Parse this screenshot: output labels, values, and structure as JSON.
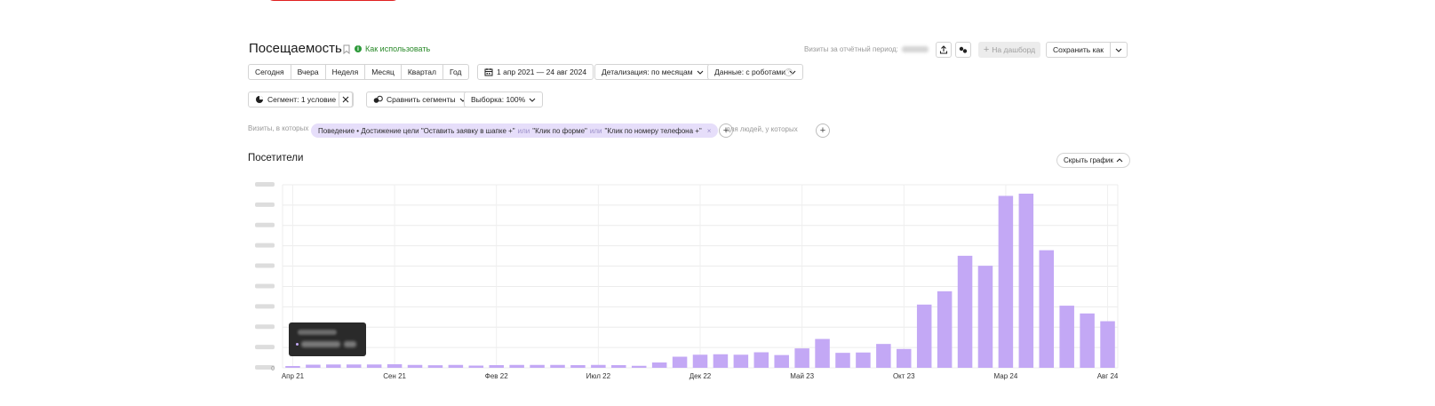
{
  "header": {
    "title": "Посещаемость",
    "how_to_use": "Как использовать",
    "visits_period_label": "Визиты за отчётный период:",
    "to_dashboard": "На дашборд",
    "save_as": "Сохранить как"
  },
  "period_buttons": [
    "Сегодня",
    "Вчера",
    "Неделя",
    "Месяц",
    "Квартал",
    "Год"
  ],
  "date_range": "1 апр 2021 — 24 авг 2024",
  "detail": "Детализация: по месяцам",
  "data_mode": "Данные: с роботами",
  "segment": "Сегмент: 1 условие",
  "compare_segments": "Сравнить сегменты",
  "sample": "Выборка: 100%",
  "filter": {
    "visits_where": "Визиты, в которых",
    "chip_part1": "Поведение • Достижение цели \"Оставить заявку в шапке +\"",
    "or1": "или",
    "chip_part2": "\"Клик по форме\"",
    "or2": "или",
    "chip_part3": "\"Клик по номеру телефона +\"",
    "people_where": "для людей, у которых"
  },
  "section": {
    "title": "Посетители",
    "hide_chart": "Скрыть график"
  },
  "colors": {
    "bar": "#c3a8f5",
    "green": "#2d9a3a"
  },
  "chart_data": {
    "type": "bar",
    "series": [
      {
        "values": [
          120,
          280,
          300,
          300,
          300,
          320,
          260,
          230,
          260,
          200,
          240,
          260,
          260,
          260,
          240,
          260,
          240,
          180,
          480,
          1000,
          1180,
          1220,
          1180,
          1400,
          1150,
          1750,
          2600,
          1350,
          1380,
          2150,
          1700,
          5700,
          6900,
          10100,
          9200,
          15500,
          15700,
          10600,
          5600,
          4900,
          4200
        ]
      }
    ],
    "categories": [
      "Апр 21",
      "Май 21",
      "Июн 21",
      "Июл 21",
      "Авг 21",
      "Сен 21",
      "Окт 21",
      "Ноя 21",
      "Дек 21",
      "Янв 22",
      "Фев 22",
      "Мар 22",
      "Апр 22",
      "Май 22",
      "Июн 22",
      "Июл 22",
      "Авг 22",
      "Сен 22",
      "Окт 22",
      "Ноя 22",
      "Дек 22",
      "Янв 23",
      "Фев 23",
      "Мар 23",
      "Апр 23",
      "Май 23",
      "Июн 23",
      "Июл 23",
      "Авг 23",
      "Сен 23",
      "Окт 23",
      "Ноя 23",
      "Дек 23",
      "Янв 24",
      "Фев 24",
      "Мар 24",
      "Апр 24",
      "Май 24",
      "Июн 24",
      "Июл 24",
      "Авг 24"
    ],
    "x_tick_labels": [
      "Апр 21",
      "Сен 21",
      "Фев 22",
      "Июл 22",
      "Дек 22",
      "Май 23",
      "Окт 23",
      "Мар 24",
      "Авг 24"
    ],
    "ylim": [
      0,
      16500
    ],
    "grid": true
  }
}
